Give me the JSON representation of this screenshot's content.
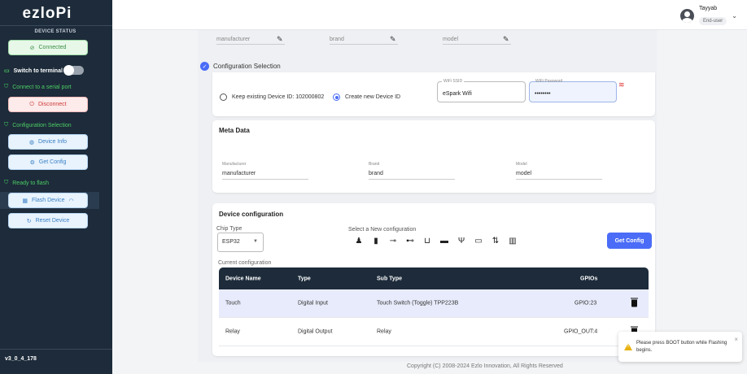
{
  "sidebar": {
    "logo": "ezloPi",
    "device_status_header": "DEVICE STATUS",
    "connected_label": "Connected",
    "switch_terminal_label": "Switch to terminal",
    "connect_serial_label": "Connect to a serial port",
    "disconnect_label": "Disconnect",
    "config_selection_label": "Configuration Selection",
    "device_info_label": "Device Info",
    "get_config_label": "Get Config",
    "ready_flash_label": "Ready to flash",
    "flash_device_label": "Flash Device",
    "reset_device_label": "Reset Device",
    "version": "v3_0_4_178"
  },
  "topbar": {
    "user_name": "Tayyab",
    "user_role": "End-user"
  },
  "top_fields": {
    "manufacturer_value": "manufacturer",
    "brand_value": "brand",
    "model_value": "model"
  },
  "config_selection": {
    "title": "Configuration Selection",
    "keep_existing_label": "Keep existing Device ID: 102000802",
    "create_new_label": "Create new Device ID",
    "wifi_ssid_label": "WiFi SSID",
    "wifi_ssid_value": "eSpark Wifi",
    "wifi_password_label": "WiFi Password",
    "wifi_password_value": "••••••••"
  },
  "meta": {
    "title": "Meta Data",
    "manufacturer_label": "Manufacturer",
    "manufacturer_value": "manufacturer",
    "brand_label": "Brand",
    "brand_value": "brand",
    "model_label": "Model",
    "model_value": "model"
  },
  "device_config": {
    "title": "Device configuration",
    "chip_type_label": "Chip Type",
    "chip_type_value": "ESP32",
    "select_new_label": "Select a New configuration",
    "get_config_button": "Get Config",
    "current_config_label": "Current configuration",
    "columns": [
      "Device Name",
      "Type",
      "Sub Type",
      "GPIOs"
    ],
    "rows": [
      {
        "name": "Touch",
        "type": "Digital Input",
        "subtype": "Touch Switch (Toggle) TPP223B",
        "gpio": "GPIO:23"
      },
      {
        "name": "Relay",
        "type": "Digital Output",
        "subtype": "Relay",
        "gpio": "GPIO_OUT:4"
      }
    ]
  },
  "footer": "Copyright (C) 2008-2024 Ezlo Innovation, All Rights Reserved",
  "toast": {
    "message": "Please press BOOT button while Flashing begins."
  },
  "colors": {
    "sidebar_bg": "#1d2b3a",
    "accent": "#4a6cf7",
    "success": "#4ccd65",
    "danger": "#cc3a3a",
    "warning": "#e8b20f"
  }
}
